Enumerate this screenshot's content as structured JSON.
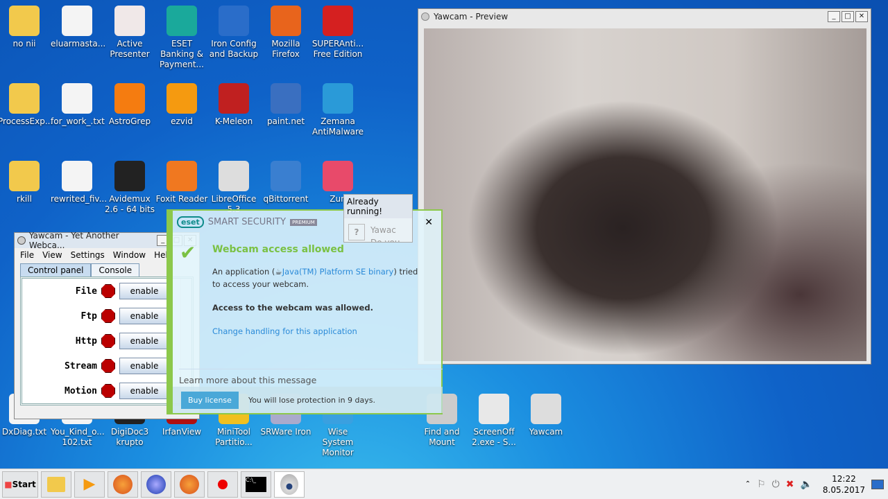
{
  "desktop": {
    "icons": [
      {
        "label": "no nii",
        "color": "#f2c94c"
      },
      {
        "label": "eluarmasta...",
        "color": "#f4f4f4"
      },
      {
        "label": "Active Presenter",
        "color": "#f0e8e8"
      },
      {
        "label": "ESET Banking & Payment...",
        "color": "#1aa99b"
      },
      {
        "label": "Iron Config and Backup",
        "color": "#2a6dc9"
      },
      {
        "label": "Mozilla Firefox",
        "color": "#e8641c"
      },
      {
        "label": "SUPERAnti... Free Edition",
        "color": "#d52020"
      },
      {
        "label": "ProcessExp...",
        "color": "#f2c94c"
      },
      {
        "label": "for_work_.txt",
        "color": "#f4f4f4"
      },
      {
        "label": "AstroGrep",
        "color": "#f57c10"
      },
      {
        "label": "ezvid",
        "color": "#f59a10"
      },
      {
        "label": "K-Meleon",
        "color": "#c02020"
      },
      {
        "label": "paint.net",
        "color": "#3a6fc0"
      },
      {
        "label": "Zemana AntiMalware",
        "color": "#2a9ad8"
      },
      {
        "label": "rkill",
        "color": "#f2c94c"
      },
      {
        "label": "rewrited_fiv...",
        "color": "#f4f4f4"
      },
      {
        "label": "Avidemux 2.6 - 64 bits",
        "color": "#222"
      },
      {
        "label": "Foxit Reader",
        "color": "#f07820"
      },
      {
        "label": "LibreOffice 5.3",
        "color": "#ddd"
      },
      {
        "label": "qBittorrent",
        "color": "#3a7fd0"
      },
      {
        "label": "Zun",
        "color": "#e84a6a"
      },
      {
        "label": "DxDiag.txt",
        "color": "#f4f4f4"
      },
      {
        "label": "You_Kind_o... 102.txt",
        "color": "#f4f4f4"
      },
      {
        "label": "DigiDoc3 krupto",
        "color": "#222"
      },
      {
        "label": "IrfanView",
        "color": "#b01010"
      },
      {
        "label": "MiniTool Partitio...",
        "color": "#f0c020"
      },
      {
        "label": "SRWare Iron",
        "color": "#aac"
      },
      {
        "label": "Wise System Monitor",
        "color": "#3aa0e0"
      },
      {
        "label": "Find and Mount",
        "color": "#ccc"
      },
      {
        "label": "ScreenOff 2.exe - S...",
        "color": "#e8e8e8"
      },
      {
        "label": "Yawcam",
        "color": "#ddd"
      }
    ]
  },
  "preview": {
    "title": "Yawcam - Preview"
  },
  "yawcam": {
    "title": "Yawcam - Yet Another Webca...",
    "menu": [
      "File",
      "View",
      "Settings",
      "Window",
      "Help"
    ],
    "tabs": [
      "Control panel",
      "Console"
    ],
    "rows": [
      {
        "label": "File",
        "button": "enable"
      },
      {
        "label": "Ftp",
        "button": "enable"
      },
      {
        "label": "Http",
        "button": "enable"
      },
      {
        "label": "Stream",
        "button": "enable"
      },
      {
        "label": "Motion",
        "button": "enable"
      }
    ]
  },
  "running": {
    "title": "Already running!",
    "line1": "Yawac",
    "line2": "Do you w"
  },
  "eset": {
    "brand": "eset",
    "product": "SMART SECURITY",
    "edition": "PREMIUM",
    "heading": "Webcam access allowed",
    "msg_pre": "An application (",
    "app": "Java(TM) Platform SE binary",
    "msg_post": ") tried to access your webcam.",
    "bold": "Access to the webcam was allowed.",
    "link": "Change handling for this application",
    "learn": "Learn more about this message",
    "buy": "Buy license",
    "warning": "You will lose protection in 9 days.",
    "accent": "#8cc84b"
  },
  "taskbar": {
    "start": "Start",
    "time": "12:22",
    "date": "8.05.2017"
  }
}
